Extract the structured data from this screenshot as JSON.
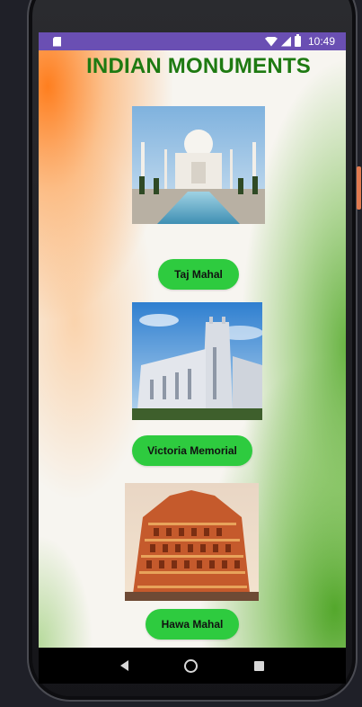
{
  "statusbar": {
    "time": "10:49"
  },
  "app": {
    "title": "INDIAN MONUMENTS"
  },
  "monuments": [
    {
      "name": "Taj Mahal",
      "button_label": "Taj Mahal"
    },
    {
      "name": "Victoria Memorial",
      "button_label": "Victoria Memorial"
    },
    {
      "name": "Hawa Mahal",
      "button_label": "Hawa Mahal"
    }
  ],
  "icons": [
    "sd-card-icon",
    "wifi-icon",
    "signal-icon",
    "battery-icon",
    "back-icon",
    "home-icon",
    "recents-icon"
  ],
  "colors": {
    "statusbar": "#6a4fb3",
    "title": "#1e7a12",
    "button": "#2ecb3f"
  }
}
